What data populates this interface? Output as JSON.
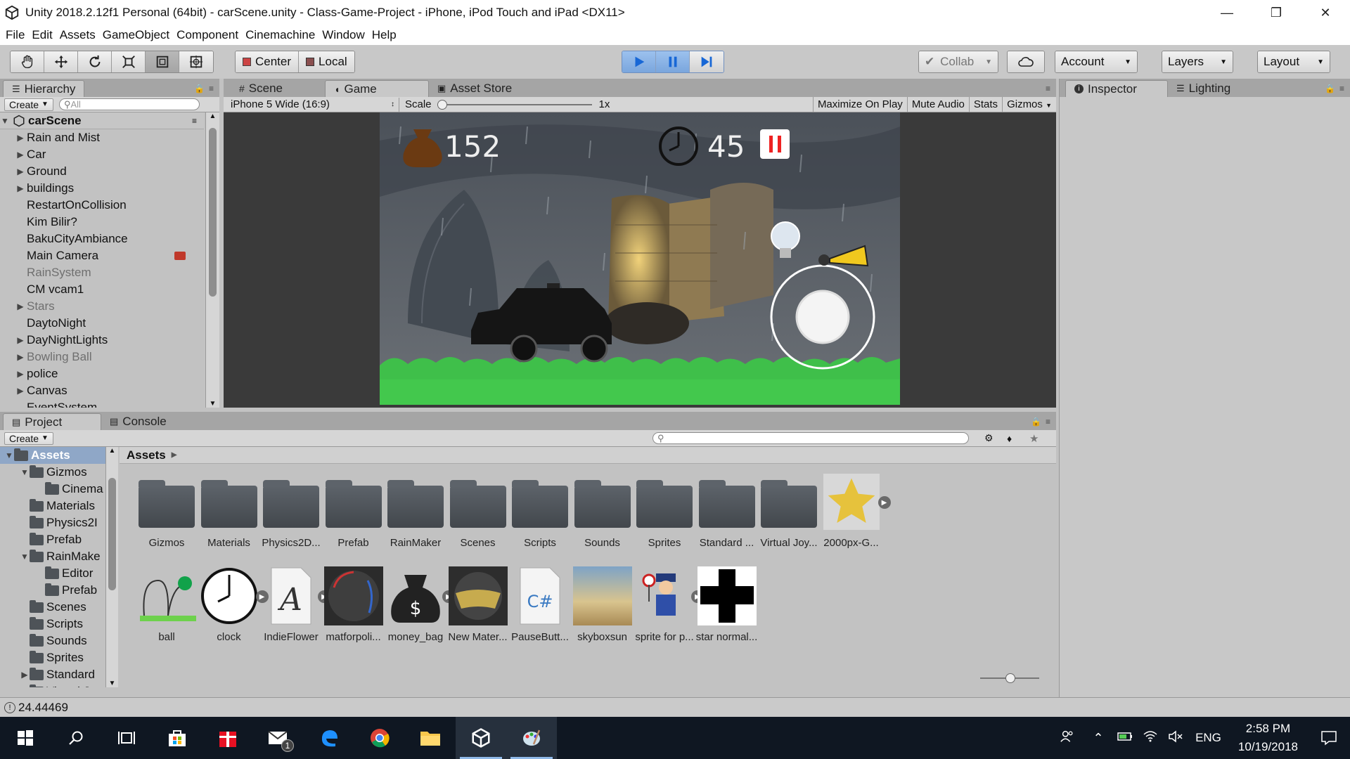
{
  "window": {
    "title": "Unity 2018.2.12f1 Personal (64bit) - carScene.unity - Class-Game-Project - iPhone, iPod Touch and iPad <DX11>"
  },
  "menu": [
    "File",
    "Edit",
    "Assets",
    "GameObject",
    "Component",
    "Cinemachine",
    "Window",
    "Help"
  ],
  "toolbar": {
    "pivot": "Center",
    "space": "Local",
    "collab": "Collab",
    "account": "Account",
    "layers": "Layers",
    "layout": "Layout"
  },
  "hierarchy": {
    "tab": "Hierarchy",
    "create": "Create",
    "search_placeholder": "All",
    "scene": "carScene",
    "items": [
      {
        "label": "Rain and Mist",
        "expandable": true,
        "dim": false
      },
      {
        "label": "Car",
        "expandable": true,
        "dim": false
      },
      {
        "label": "Ground",
        "expandable": true,
        "dim": false
      },
      {
        "label": "buildings",
        "expandable": true,
        "dim": false
      },
      {
        "label": "RestartOnCollision",
        "expandable": false,
        "dim": false
      },
      {
        "label": "Kim Bilir?",
        "expandable": false,
        "dim": false
      },
      {
        "label": "BakuCityAmbiance",
        "expandable": false,
        "dim": false
      },
      {
        "label": "Main Camera",
        "expandable": false,
        "dim": false
      },
      {
        "label": "RainSystem",
        "expandable": false,
        "dim": true
      },
      {
        "label": "CM vcam1",
        "expandable": false,
        "dim": false
      },
      {
        "label": "Stars",
        "expandable": true,
        "dim": true
      },
      {
        "label": "DaytoNight",
        "expandable": false,
        "dim": false
      },
      {
        "label": "DayNightLights",
        "expandable": true,
        "dim": false
      },
      {
        "label": "Bowling Ball",
        "expandable": true,
        "dim": true
      },
      {
        "label": "police",
        "expandable": true,
        "dim": false
      },
      {
        "label": "Canvas",
        "expandable": true,
        "dim": false
      },
      {
        "label": "EventSystem",
        "expandable": false,
        "dim": false
      }
    ]
  },
  "center": {
    "tabs": [
      "Scene",
      "Game",
      "Asset Store"
    ],
    "active_tab": "Game",
    "resolution": "iPhone 5 Wide (16:9)",
    "scale_label": "Scale",
    "scale_value": "1x",
    "options": [
      "Maximize On Play",
      "Mute Audio",
      "Stats",
      "Gizmos"
    ]
  },
  "game_hud": {
    "money": "152",
    "time": "45"
  },
  "inspector": {
    "tabs": [
      "Inspector",
      "Lighting"
    ]
  },
  "project": {
    "tabs": [
      "Project",
      "Console"
    ],
    "create": "Create",
    "breadcrumb": "Assets",
    "tree": [
      {
        "label": "Assets",
        "level": 0,
        "arrow": "down",
        "bold": true
      },
      {
        "label": "Gizmos",
        "level": 1,
        "arrow": "down"
      },
      {
        "label": "Cinema",
        "level": 2,
        "arrow": ""
      },
      {
        "label": "Materials",
        "level": 1,
        "arrow": ""
      },
      {
        "label": "Physics2I",
        "level": 1,
        "arrow": ""
      },
      {
        "label": "Prefab",
        "level": 1,
        "arrow": ""
      },
      {
        "label": "RainMake",
        "level": 1,
        "arrow": "down"
      },
      {
        "label": "Editor",
        "level": 2,
        "arrow": ""
      },
      {
        "label": "Prefab",
        "level": 2,
        "arrow": ""
      },
      {
        "label": "Scenes",
        "level": 1,
        "arrow": ""
      },
      {
        "label": "Scripts",
        "level": 1,
        "arrow": ""
      },
      {
        "label": "Sounds",
        "level": 1,
        "arrow": ""
      },
      {
        "label": "Sprites",
        "level": 1,
        "arrow": ""
      },
      {
        "label": "Standard",
        "level": 1,
        "arrow": "right"
      },
      {
        "label": "Virtual Jo",
        "level": 1,
        "arrow": "right"
      }
    ],
    "row1": [
      {
        "label": "Gizmos",
        "kind": "folder"
      },
      {
        "label": "Materials",
        "kind": "folder"
      },
      {
        "label": "Physics2D...",
        "kind": "folder"
      },
      {
        "label": "Prefab",
        "kind": "folder"
      },
      {
        "label": "RainMaker",
        "kind": "folder"
      },
      {
        "label": "Scenes",
        "kind": "folder"
      },
      {
        "label": "Scripts",
        "kind": "folder"
      },
      {
        "label": "Sounds",
        "kind": "folder"
      },
      {
        "label": "Sprites",
        "kind": "folder"
      },
      {
        "label": "Standard ...",
        "kind": "folder"
      },
      {
        "label": "Virtual Joy...",
        "kind": "folder"
      },
      {
        "label": "2000px-G...",
        "kind": "star"
      }
    ],
    "row2": [
      {
        "label": "ball",
        "kind": "ball"
      },
      {
        "label": "clock",
        "kind": "clock"
      },
      {
        "label": "IndieFlower",
        "kind": "font"
      },
      {
        "label": "matforpoli...",
        "kind": "matpol"
      },
      {
        "label": "money_bag",
        "kind": "moneybag"
      },
      {
        "label": "New Mater...",
        "kind": "material"
      },
      {
        "label": "PauseButt...",
        "kind": "script"
      },
      {
        "label": "skyboxsun",
        "kind": "skybox"
      },
      {
        "label": "sprite for p...",
        "kind": "police"
      },
      {
        "label": "star normal...",
        "kind": "starnormal"
      }
    ]
  },
  "status": {
    "message": "24.44469"
  },
  "taskbar": {
    "lang": "ENG",
    "time": "2:58 PM",
    "date": "10/19/2018",
    "mail_badge": "1"
  },
  "colors": {
    "accent": "#7aa6dd",
    "panel": "#c2c2c2",
    "taskbar": "#0f1722",
    "grass": "#3fbf4a"
  }
}
